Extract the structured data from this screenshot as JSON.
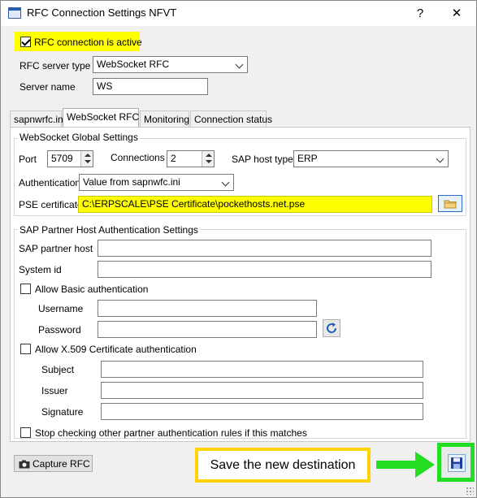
{
  "window": {
    "title": "RFC Connection Settings NFVT",
    "help_label": "?",
    "close_label": "✕"
  },
  "connection": {
    "active_label": "RFC connection is active",
    "active_checked": true,
    "server_type_label": "RFC server type",
    "server_type_value": "WebSocket RFC",
    "server_name_label": "Server name",
    "server_name_value": "WS"
  },
  "tabs": [
    {
      "label": "sapnwrfc.ini"
    },
    {
      "label": "WebSocket RFC",
      "active": true
    },
    {
      "label": "Monitoring"
    },
    {
      "label": "Connection status"
    }
  ],
  "global": {
    "title": "WebSocket Global Settings",
    "port_label": "Port",
    "port_value": "5709",
    "connections_label": "Connections",
    "connections_value": "2",
    "host_type_label": "SAP host type",
    "host_type_value": "ERP",
    "auth_label": "Authentication",
    "auth_value": "Value from sapnwfc.ini",
    "pse_label": "PSE certificate",
    "pse_value": "C:\\ERPSCALE\\PSE Certificate\\pockethosts.net.pse"
  },
  "partner": {
    "title": "SAP Partner Host Authentication Settings",
    "host_label": "SAP partner host",
    "host_value": "",
    "system_id_label": "System id",
    "system_id_value": "",
    "basic_auth_label": "Allow Basic authentication",
    "basic_auth_checked": false,
    "username_label": "Username",
    "username_value": "",
    "password_label": "Password",
    "password_value": "",
    "x509_label": "Allow X.509 Certificate authentication",
    "x509_checked": false,
    "subject_label": "Subject",
    "subject_value": "",
    "issuer_label": "Issuer",
    "issuer_value": "",
    "signature_label": "Signature",
    "signature_value": "",
    "stop_label": "Stop checking other partner authentication rules if this matches",
    "stop_checked": false
  },
  "footer": {
    "capture_label": "Capture RFC",
    "callout_text": "Save the new destination"
  },
  "colors": {
    "highlight": "#ffff00",
    "callout_border": "#ffd400",
    "arrow": "#22dd22",
    "browse_border": "#2a6cc7"
  },
  "icons": [
    "app-icon",
    "camera-icon",
    "folder-icon",
    "refresh-icon",
    "save-icon",
    "chevron-down-icon",
    "close-icon",
    "help-icon"
  ]
}
